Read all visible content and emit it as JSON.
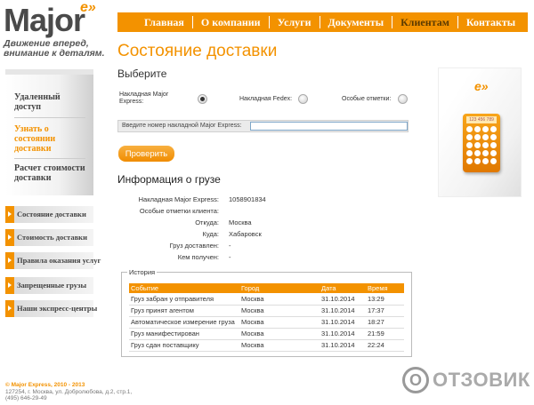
{
  "logo": {
    "word": "Major",
    "mark": "e»",
    "slogan_line1": "Движение вперед,",
    "slogan_line2": "внимание к деталям."
  },
  "topnav": [
    "Главная",
    "О компании",
    "Услуги",
    "Документы",
    "Клиентам",
    "Контакты"
  ],
  "topnav_active": "Клиентам",
  "sidebar": {
    "items": [
      {
        "label_l1": "Удаленный",
        "label_l2": "доступ",
        "l3": ""
      },
      {
        "label_l1": "Узнать о",
        "label_l2": "состоянии",
        "l3": "доставки"
      },
      {
        "label_l1": "Расчет стоимости",
        "label_l2": "доставки",
        "l3": ""
      }
    ],
    "menu": [
      "Состояние доставки",
      "Стоимость доставки",
      "Правила оказания услуг",
      "Запрещенные грузы",
      "Наши экспресс-центры"
    ]
  },
  "main": {
    "title": "Состояние доставки",
    "choose": "Выберите",
    "radios": [
      {
        "label": "Накладная Major Express:",
        "checked": true
      },
      {
        "label": "Накладная Fedex:",
        "checked": false
      },
      {
        "label": "Особые отметки:",
        "checked": false
      }
    ],
    "input_label": "Введите номер накладной Major Express:",
    "input_value": "",
    "button": "Проверить",
    "info_title": "Информация о грузе",
    "info": [
      {
        "k": "Накладная Major Express:",
        "v": "1058901834"
      },
      {
        "k": "Особые отметки клиента:",
        "v": ""
      },
      {
        "k": "Откуда:",
        "v": "Москва"
      },
      {
        "k": "Куда:",
        "v": "Хабаровск"
      },
      {
        "k": "Груз доставлен:",
        "v": "-"
      },
      {
        "k": "Кем получен:",
        "v": "-"
      }
    ],
    "history_legend": "История",
    "history_headers": [
      "Событие",
      "Город",
      "Дата",
      "Время"
    ],
    "history_rows": [
      [
        "Груз забран у отправителя",
        "Москва",
        "31.10.2014",
        "13:29"
      ],
      [
        "Груз принят агентом",
        "Москва",
        "31.10.2014",
        "17:37"
      ],
      [
        "Автоматическое измерение груза",
        "Москва",
        "31.10.2014",
        "18:27"
      ],
      [
        "Груз манифестирован",
        "Москва",
        "31.10.2014",
        "21:59"
      ],
      [
        "Груз сдан поставщику",
        "Москва",
        "31.10.2014",
        "22:24"
      ]
    ]
  },
  "promo": {
    "mark": "e»",
    "screen": "123 456 789"
  },
  "footer": {
    "copy": "© Major Express, 2010 - 2013",
    "address": "127254, г. Москва, ул. Добролюбова, д.2, стр.1,",
    "phone": "(495) 646-29-49"
  },
  "watermark": {
    "letter": "O",
    "text": "ОТЗОВИК"
  }
}
